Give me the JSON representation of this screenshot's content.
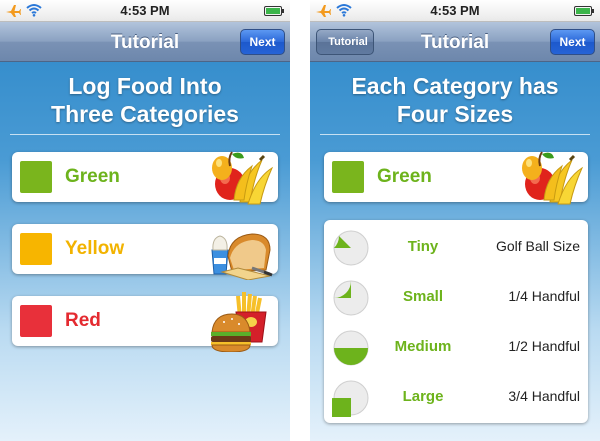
{
  "status": {
    "time": "4:53 PM"
  },
  "left": {
    "nav_title": "Tutorial",
    "next_label": "Next",
    "heading_line1": "Log Food Into",
    "heading_line2": "Three Categories",
    "categories": [
      {
        "label": "Green",
        "color": "#7ab51d"
      },
      {
        "label": "Yellow",
        "color": "#f7b500"
      },
      {
        "label": "Red",
        "color": "#e8303a"
      }
    ]
  },
  "right": {
    "back_label": "Tutorial",
    "nav_title": "Tutorial",
    "next_label": "Next",
    "heading_line1": "Each Category has",
    "heading_line2": "Four Sizes",
    "category": {
      "label": "Green",
      "color": "#7ab51d"
    },
    "sizes": [
      {
        "name": "Tiny",
        "description": "Golf Ball Size",
        "fraction": 0.125
      },
      {
        "name": "Small",
        "description": "1/4 Handful",
        "fraction": 0.25
      },
      {
        "name": "Medium",
        "description": "1/2 Handful",
        "fraction": 0.5
      },
      {
        "name": "Large",
        "description": "3/4 Handful",
        "fraction": 0.75
      }
    ]
  },
  "icons": {
    "status": [
      "airplane-icon",
      "wifi-icon",
      "battery-icon"
    ],
    "foods": [
      "fruit-icon",
      "dairy-bread-icon",
      "fast-food-icon"
    ]
  }
}
